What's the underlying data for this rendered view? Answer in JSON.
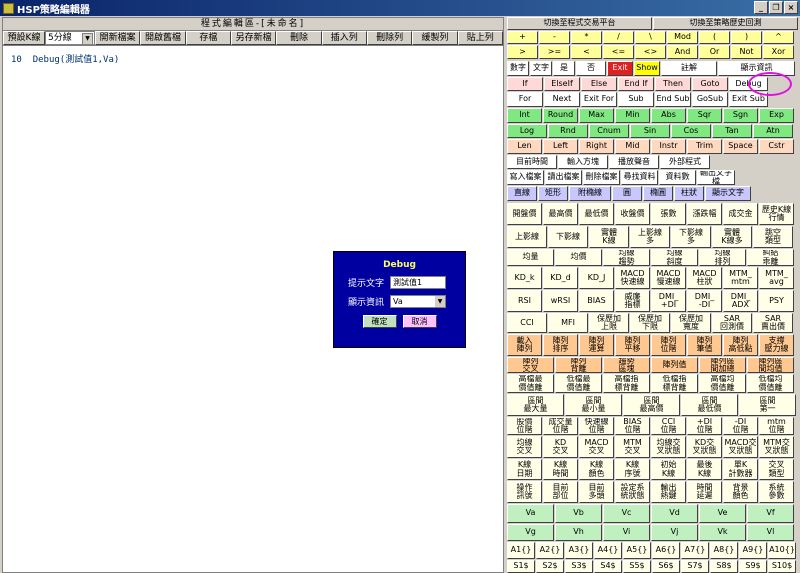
{
  "window": {
    "title": "HSP策略編輯器",
    "controls": [
      "_",
      "❐",
      "×"
    ]
  },
  "editor": {
    "doc_title": "程式編輯區-[未命名]",
    "toolbar": {
      "preset_label": "預設K線",
      "preset_value": "5分線",
      "buttons": [
        "開新檔案",
        "開啟舊檔",
        "存檔",
        "另存新檔",
        "刪除",
        "插入列",
        "刪除列",
        "緩製列",
        "貼上列"
      ]
    },
    "code_lines": [
      {
        "num": "10",
        "text": "Debug(測試值1,Va)"
      }
    ]
  },
  "dialog": {
    "title": "Debug",
    "prompt_label": "提示文字",
    "prompt_value": "測試值1",
    "show_label": "顯示資訊",
    "show_value": "Va",
    "ok": "確定",
    "cancel": "取消"
  },
  "palette": {
    "rows": [
      {
        "bg": "#d4d0c8",
        "cells": [
          "切換至程式交易平台",
          "切換至策略歷史回測"
        ]
      },
      {
        "bg": "#ffff99",
        "cells": [
          "+",
          "-",
          "*",
          "/",
          "\\",
          "Mod",
          "(",
          ")",
          "^"
        ]
      },
      {
        "bg": "#ffff99",
        "cells": [
          ">",
          ">=",
          "<",
          "<=",
          "<>",
          "And",
          "Or",
          "Not",
          "Xor"
        ]
      },
      {
        "bg": "#ffffff",
        "cells": [
          "數字",
          "文字",
          "是",
          "否",
          "Exit",
          "Show",
          "註解",
          "顯示資訊"
        ]
      },
      {
        "bg": "#ffd8d8",
        "cells": [
          "If",
          "ElseIf",
          "Else",
          "End If",
          "Then",
          "Goto",
          "Debug"
        ]
      },
      {
        "bg": "#ffffff",
        "cells": [
          "For",
          "Next",
          "Exit For",
          "Sub",
          "End Sub",
          "GoSub",
          "Exit Sub"
        ]
      },
      {
        "bg": "#80e880",
        "cells": [
          "Int",
          "Round",
          "Max",
          "Min",
          "Abs",
          "Sqr",
          "Sgn",
          "Exp"
        ]
      },
      {
        "bg": "#80e880",
        "cells": [
          "Log",
          "Rnd",
          "Cnum",
          "Sin",
          "Cos",
          "Tan",
          "Atn"
        ]
      },
      {
        "bg": "#ffd8c0",
        "cells": [
          "Len",
          "Left",
          "Right",
          "Mid",
          "Instr",
          "Trim",
          "Space",
          "Cstr"
        ]
      },
      {
        "bg": "#ffffff",
        "cells": [
          "目前時間",
          "輸入方塊",
          "播放聲音",
          "外部程式"
        ]
      },
      {
        "bg": "#ffffff",
        "cells": [
          "寫入檔案",
          "讀出檔案",
          "刪除檔案",
          "尋找資料",
          "資料數",
          "輸出文字檔"
        ]
      },
      {
        "bg": "#c8c8ff",
        "cells": [
          "直線",
          "矩形",
          "附橢線",
          "圓",
          "橢圓",
          "柱狀",
          "顯示文字"
        ]
      },
      {
        "bg": "#ffffe8",
        "cells": [
          "開盤價",
          "最高價",
          "最低價",
          "收盤價",
          "張數",
          "漲跌幅",
          "成交金",
          "歷史K線\n行情"
        ]
      },
      {
        "bg": "#ffffe8",
        "cells": [
          "上影線",
          "下影線",
          "實體\nK線",
          "上影線\n多",
          "下影線\n多",
          "實體\nK線多",
          "跳空\n類型"
        ]
      },
      {
        "bg": "#ffffe8",
        "cells": [
          "均量",
          "均價",
          "均線\n趨勢",
          "均線\n斜度",
          "均線\n排列",
          "糾結\n乖離"
        ]
      },
      {
        "bg": "#ffffe8",
        "cells": [
          "KD_k",
          "KD_d",
          "KD_J",
          "MACD\n快速線",
          "MACD\n慢速線",
          "MACD\n柱狀",
          "MTM_\nmtm",
          "MTM_\navg"
        ]
      },
      {
        "bg": "#ffffe8",
        "cells": [
          "RSI",
          "wRSI",
          "BIAS",
          "威廉\n指標",
          "DMI_\n+DI",
          "DMI_\n-DI",
          "DMI_\nADX",
          "PSY"
        ]
      },
      {
        "bg": "#ffffe8",
        "cells": [
          "CCI",
          "MFI",
          "保歷加\n上限",
          "保歷加\n下限",
          "保歷加\n寬度",
          "SAR\n回測價",
          "SAR\n賣出價"
        ]
      },
      {
        "bg": "#ffc890",
        "cells": [
          "載入\n陣列",
          "陣列\n排序",
          "陣列\n運算",
          "陣列\n平移",
          "陣列\n位階",
          "陣列\n筆值",
          "陣列\n高低點",
          "支撐\n壓力線"
        ]
      },
      {
        "bg": "#ffc890",
        "cells": [
          "陣列\n交叉",
          "陣列\n背離",
          "趨勢\n區塊",
          "陣列值",
          "陣列區\n間加總",
          "陣列區\n間均值"
        ]
      },
      {
        "bg": "#ffffe8",
        "cells": [
          "高檔最\n價值離",
          "低檔最\n價值離",
          "高檔指\n標背離",
          "低檔指\n標背離",
          "高檔均\n價值離",
          "低檔均\n價值離"
        ]
      },
      {
        "bg": "#ffffe8",
        "cells": [
          "區間\n最大量",
          "區間\n最小量",
          "區間\n最高價",
          "區間\n最低價",
          "區間\n第一"
        ]
      },
      {
        "bg": "#ffffe8",
        "cells": [
          "股價\n位階",
          "成交量\n位階",
          "快速線\n位階",
          "BIAS\n位階",
          "CCI\n位階",
          "+DI\n位階",
          "-DI\n位階",
          "mtm\n位階"
        ]
      },
      {
        "bg": "#ffffe8",
        "cells": [
          "均線\n交叉",
          "KD\n交叉",
          "MACD\n交叉",
          "MTM\n交叉",
          "均線交\n叉狀態",
          "KD交\n叉狀態",
          "MACD交\n叉狀態",
          "MTM交\n叉狀態"
        ]
      },
      {
        "bg": "#ffffe8",
        "cells": [
          "K線\n日期",
          "K線\n時間",
          "K線\n顏色",
          "K線\n序號",
          "初始\nK線",
          "最後\nK線",
          "單K\n計數器",
          "交叉\n類型"
        ]
      },
      {
        "bg": "#ffffe8",
        "cells": [
          "操作\n訊號",
          "目前\n部位",
          "目前\n多頭",
          "設定系\n統狀態",
          "輸出\n熱鍵",
          "時間\n延遲",
          "背景\n顏色",
          "系統\n參數"
        ]
      },
      {
        "bg": "#c0f0c0",
        "cells": [
          "Va",
          "Vb",
          "Vc",
          "Vd",
          "Ve",
          "Vf"
        ]
      },
      {
        "bg": "#c0f0c0",
        "cells": [
          "Vg",
          "Vh",
          "Vi",
          "Vj",
          "Vk",
          "Vl"
        ]
      },
      {
        "bg": "#ffffe8",
        "cells": [
          "A1{}",
          "A2{}",
          "A3{}",
          "A4{}",
          "A5{}",
          "A6{}",
          "A7{}",
          "A8{}",
          "A9{}",
          "A10{}"
        ]
      },
      {
        "bg": "#ffffe8",
        "cells": [
          "S1$",
          "S2$",
          "S3$",
          "S4$",
          "S5$",
          "S6$",
          "S7$",
          "S8$",
          "S9$",
          "S10$"
        ]
      }
    ]
  },
  "special_colors": {
    "Exit": "#e02020",
    "Show": "#ffff00",
    "Debug": "#ffffff"
  }
}
